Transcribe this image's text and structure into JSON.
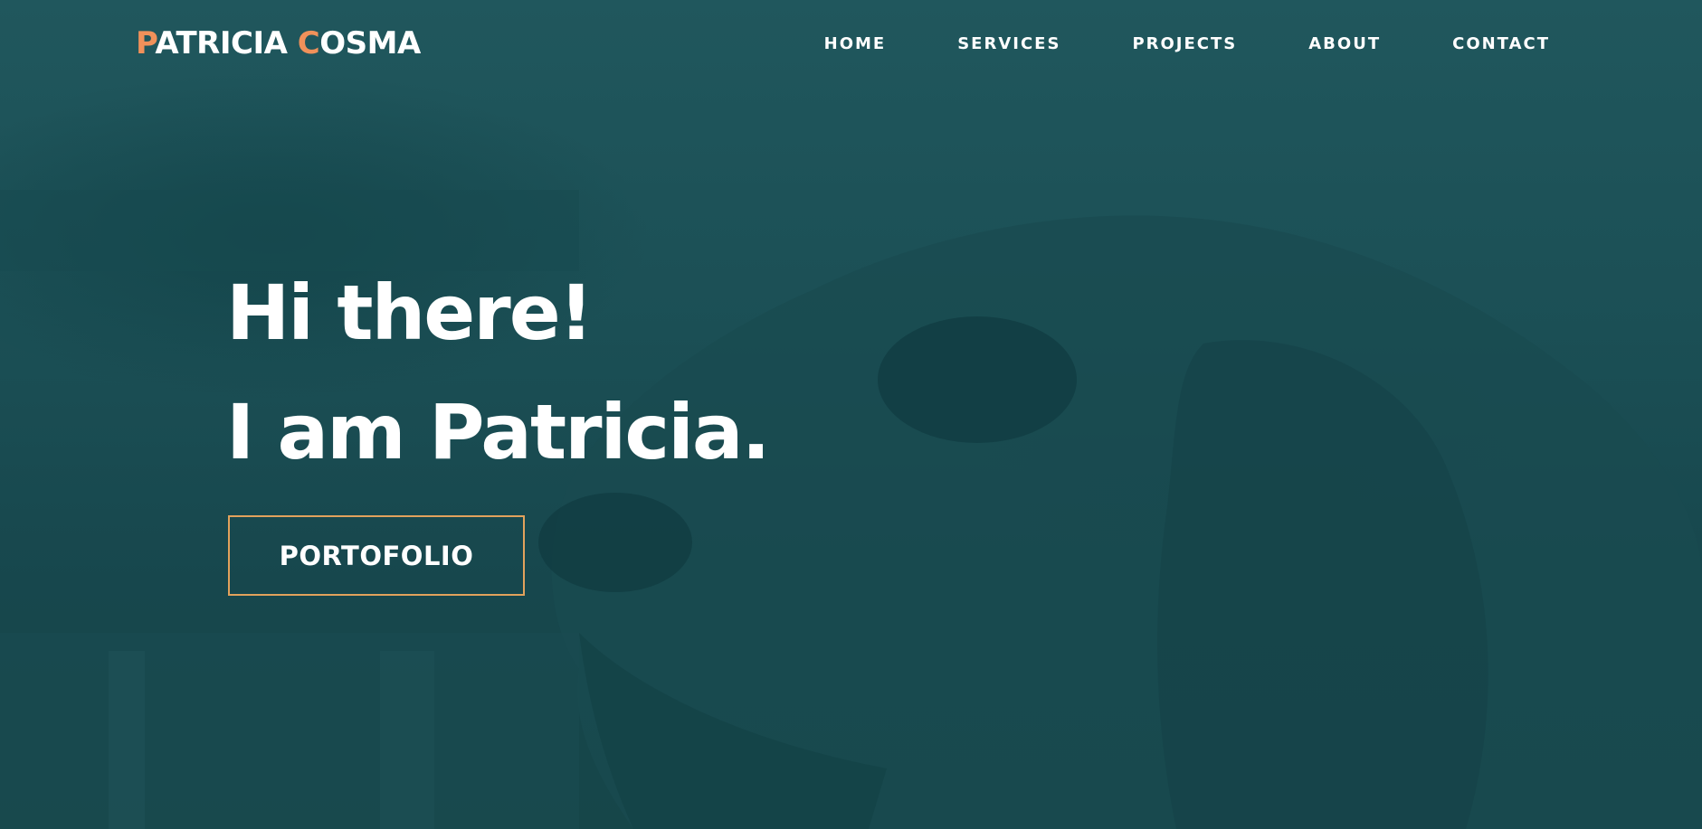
{
  "header": {
    "logo": {
      "first_initial": "P",
      "first_rest": "ATRICIA",
      "last_initial": "C",
      "last_rest": "OSMA"
    },
    "nav": [
      {
        "label": "HOME"
      },
      {
        "label": "SERVICES"
      },
      {
        "label": "PROJECTS"
      },
      {
        "label": "ABOUT"
      },
      {
        "label": "CONTACT"
      }
    ]
  },
  "hero": {
    "line1": "Hi there!",
    "line2": "I am Patricia.",
    "button_label": "PORTOFOLIO",
    "background_image": "dog-photo"
  },
  "colors": {
    "overlay": "#1d5257",
    "logo_accent": "#f0915a",
    "button_border": "#e2a25c",
    "text": "#ffffff"
  }
}
